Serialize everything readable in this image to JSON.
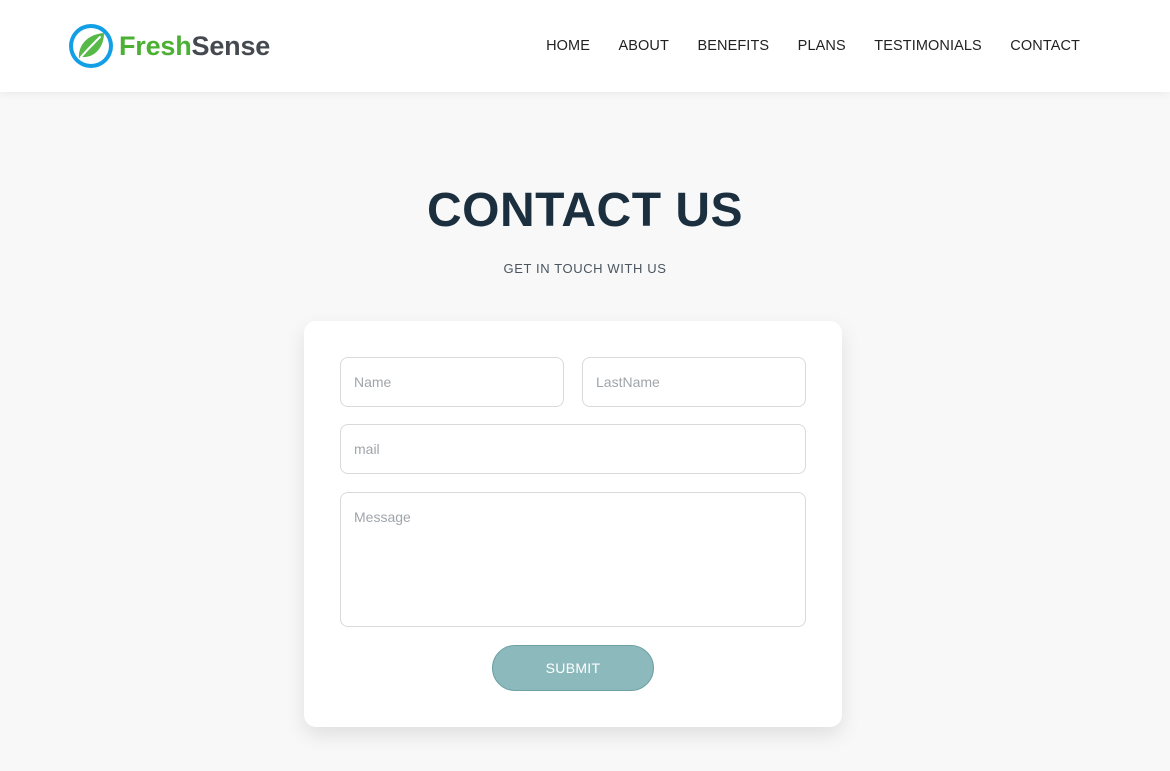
{
  "brand": {
    "part1": "Fresh",
    "part2": "Sense",
    "colors": {
      "fresh": "#4cb034",
      "sense": "#444a4f",
      "icon_blue": "#139fe6",
      "icon_leaf": "#57b948"
    }
  },
  "nav": {
    "items": [
      {
        "label": "HOME"
      },
      {
        "label": "ABOUT"
      },
      {
        "label": "BENEFITS"
      },
      {
        "label": "PLANS"
      },
      {
        "label": "TESTIMONIALS"
      },
      {
        "label": "CONTACT"
      }
    ]
  },
  "hero": {
    "title": "CONTACT US",
    "subtitle": "GET IN TOUCH WITH US"
  },
  "form": {
    "name_placeholder": "Name",
    "lastname_placeholder": "LastName",
    "mail_placeholder": "mail",
    "message_placeholder": "Message",
    "submit_label": "SUBMIT",
    "submit_color": "#8cb9bc"
  }
}
